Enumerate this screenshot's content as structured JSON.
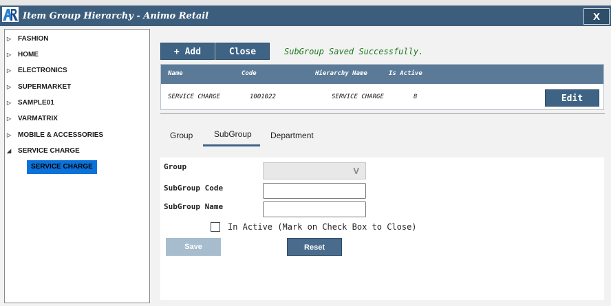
{
  "window": {
    "title": "Item Group Hierarchy - Animo Retail",
    "close_label": "X"
  },
  "sidebar": {
    "items": [
      {
        "label": "FASHION"
      },
      {
        "label": "HOME"
      },
      {
        "label": "ELECTRONICS"
      },
      {
        "label": "SUPERMARKET"
      },
      {
        "label": "SAMPLE01"
      },
      {
        "label": "VARMATRIX"
      },
      {
        "label": "MOBILE & ACCESSORIES"
      },
      {
        "label": "SERVICE CHARGE",
        "expanded": true
      }
    ],
    "selected_child": "SERVICE CHARGE"
  },
  "toolbar": {
    "add_label": "+ Add",
    "close_label": "Close",
    "status_message": "SubGroup Saved Successfully."
  },
  "grid": {
    "columns": [
      "Name",
      "Code",
      "Hierarchy Name",
      "Is Active"
    ],
    "row": {
      "name": "SERVICE CHARGE",
      "code": "1001022",
      "hierarchy": "SERVICE CHARGE",
      "is_active": "8"
    },
    "edit_label": "Edit"
  },
  "tabs": {
    "group": "Group",
    "subgroup": "SubGroup",
    "department": "Department",
    "active": "SubGroup"
  },
  "form": {
    "group_label": "Group",
    "group_value": "",
    "subgroup_code_label": "SubGroup Code",
    "subgroup_code_value": "",
    "subgroup_name_label": "SubGroup Name",
    "subgroup_name_value": "",
    "inactive_label": "In Active (Mark on Check Box to Close)",
    "save_label": "Save",
    "reset_label": "Reset",
    "dropdown_glyph": "V"
  },
  "colors": {
    "titlebar": "#3c5e7c",
    "button": "#3e6385",
    "status_green": "#1e7a1e",
    "selected_node": "#0b72d9"
  }
}
